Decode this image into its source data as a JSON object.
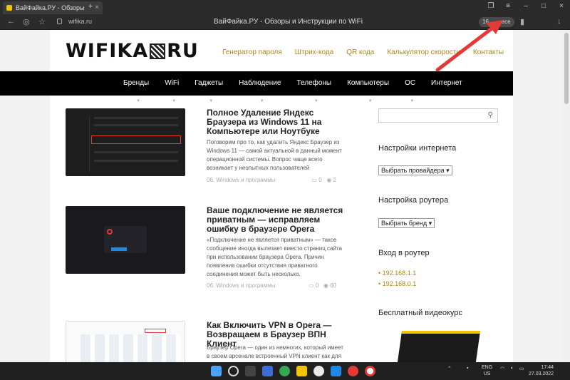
{
  "browser": {
    "tab_title": "ВайФайка.РУ - Обзоры",
    "url": "wifika.ru",
    "page_title": "ВайФайка.РУ - Обзоры и Инструкции по WiFi",
    "badge": "16     ...есе"
  },
  "site": {
    "logo_left": "WIFIKA",
    "logo_right": "RU",
    "toplinks": [
      "Генератор пароля",
      "Штрих-кода",
      "QR кода",
      "Калькулятор скорости",
      "Контакты"
    ],
    "menu": [
      "Бренды",
      "WiFi",
      "Гаджеты",
      "Наблюдение",
      "Телефоны",
      "Компьютеры",
      "ОС",
      "Интернет"
    ]
  },
  "posts": [
    {
      "title": "Полное Удаление Яндекс Браузера из Windows 11 на Компьютере или Ноутбуке",
      "excerpt": "Поговорим про то, как удалить Яндекс Браузер из Windows 11 — самой актуальной в данный момент операционной системы. Вопрос чаще всего возникает у неопытных пользователей",
      "category": "06. Windows и программы",
      "comments": "0",
      "views": "2"
    },
    {
      "title": "Ваше подключение не является приватным — исправляем ошибку в браузере Opera",
      "excerpt": "«Подключение не является приватным» — такое сообщение иногда вылезает вместо страниц сайта при использовании браузера Opera. Причин появления ошибки отсутствия приватного соединения может быть несколько.",
      "category": "06. Windows и программы",
      "comments": "0",
      "views": "60"
    },
    {
      "title": "Как Включить VPN в Opera — Возвращаем в Браузер ВПН Клиент",
      "excerpt": "Браузер Opera — один из немногих, который имеет в своем арсенале встроенный VPN клиент как для",
      "category": "",
      "comments": "",
      "views": ""
    }
  ],
  "sidebar": {
    "search_placeholder": "",
    "h_internet": "Настройки интернета",
    "sel_provider": "Выбрать провайдера",
    "h_router": "Настройка роутера",
    "sel_brand": "Выбрать бренд",
    "h_login": "Вход в роутер",
    "ips": [
      "192.168.1.1",
      "192.168.0.1"
    ],
    "h_course": "Бесплатный видеокурс"
  },
  "taskbar": {
    "lang": "ENG",
    "lang2": "US",
    "time": "17:44",
    "date": "27.03.2022"
  },
  "colors": {
    "accent": "#b8860b",
    "menu_bg": "#000000",
    "arrow": "#e53935"
  }
}
